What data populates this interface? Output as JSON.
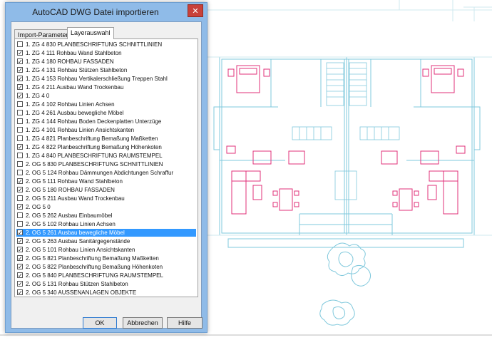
{
  "dialog": {
    "title": "AutoCAD DWG Datei importieren",
    "close_glyph": "✕",
    "tabs": [
      {
        "label": "Import-Parameter",
        "active": false
      },
      {
        "label": "Layerauswahl",
        "active": true
      }
    ],
    "layers": [
      {
        "label": "1. ZG 4 830 PLANBESCHRIFTUNG SCHNITTLINIEN",
        "checked": false
      },
      {
        "label": "1. ZG 4 111 Rohbau Wand Stahlbeton",
        "checked": true
      },
      {
        "label": "1. ZG 4 180 ROHBAU FASSADEN",
        "checked": true
      },
      {
        "label": "1. ZG 4 131 Rohbau Stützen Stahlbeton",
        "checked": true
      },
      {
        "label": "1. ZG 4 153 Rohbau Vertikalerschließung Treppen Stahl",
        "checked": true
      },
      {
        "label": "1. ZG 4 211 Ausbau Wand Trockenbau",
        "checked": true
      },
      {
        "label": "1. ZG 4 0",
        "checked": true
      },
      {
        "label": "1. ZG 4 102 Rohbau Linien Achsen",
        "checked": false
      },
      {
        "label": "1. ZG 4 261 Ausbau bewegliche Möbel",
        "checked": false
      },
      {
        "label": "1. ZG 4 144 Rohbau Boden Deckenplatten Unterzüge",
        "checked": false
      },
      {
        "label": "1. ZG 4 101 Rohbau Linien Ansichtskanten",
        "checked": false
      },
      {
        "label": "1. ZG 4 821 Planbeschriftung Bemaßung Maßketten",
        "checked": false
      },
      {
        "label": "1. ZG 4 822 Planbeschriftung Bemaßung Höhenkoten",
        "checked": true
      },
      {
        "label": "1. ZG 4 840 PLANBESCHRIFTUNG RAUMSTEMPEL",
        "checked": false
      },
      {
        "label": "2. OG 5 830 PLANBESCHRIFTUNG SCHNITTLINIEN",
        "checked": false
      },
      {
        "label": "2. OG 5 124 Rohbau Dämmungen Abdichtungen Schraffur",
        "checked": false
      },
      {
        "label": "2. OG 5 111 Rohbau Wand Stahlbeton",
        "checked": true
      },
      {
        "label": "2. OG 5 180 ROHBAU FASSADEN",
        "checked": true
      },
      {
        "label": "2. OG 5 211 Ausbau Wand Trockenbau",
        "checked": false
      },
      {
        "label": "2. OG 5 0",
        "checked": true
      },
      {
        "label": "2. OG 5 262 Ausbau Einbaumöbel",
        "checked": false
      },
      {
        "label": "2. OG 5 102 Rohbau Linien Achsen",
        "checked": false
      },
      {
        "label": "2. OG 5 261 Ausbau bewegliche Möbel",
        "checked": true,
        "selected": true
      },
      {
        "label": "2. OG 5 263 Ausbau Sanitärgegenstände",
        "checked": true
      },
      {
        "label": "2. OG 5 101 Rohbau Linien Ansichtskanten",
        "checked": true
      },
      {
        "label": "2. OG 5 821 Planbeschriftung Bemaßung Maßketten",
        "checked": true
      },
      {
        "label": "2. OG 5 822 Planbeschriftung Bemaßung Höhenkoten",
        "checked": true
      },
      {
        "label": "2. OG 5 840 PLANBESCHRIFTUNG RAUMSTEMPEL",
        "checked": true
      },
      {
        "label": "2. OG 5 131 Rohbau Stützen Stahlbeton",
        "checked": true
      },
      {
        "label": "2. OG 5 340 AUSSENANLAGEN OBJEKTE",
        "checked": true
      }
    ],
    "buttons": {
      "ok": "OK",
      "cancel": "Abbrechen",
      "help": "Hilfe"
    },
    "check_glyph": "✓"
  },
  "colors": {
    "cad_wall": "#7fc8dc",
    "cad_furniture": "#e0307a",
    "selection": "#3399ff",
    "dialog_frame": "#8fbbe8"
  }
}
